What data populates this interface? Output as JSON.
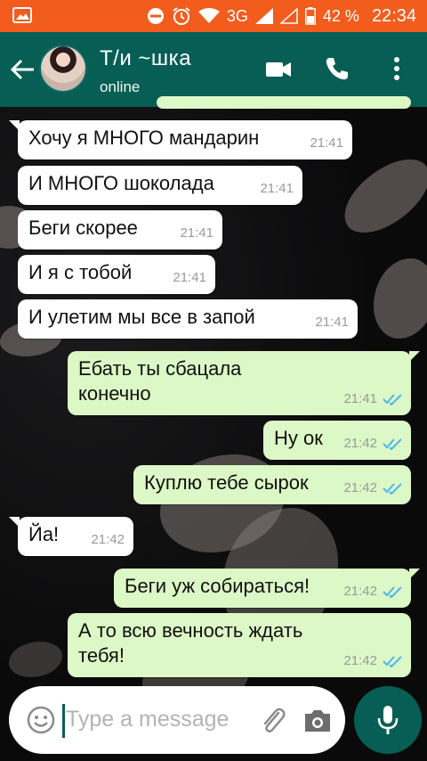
{
  "status_bar": {
    "battery_percent": "42 %",
    "network": "3G",
    "time": "22:34",
    "color": "#f25c1d"
  },
  "header": {
    "contact_name": "Т/и ~шка",
    "status": "online",
    "color": "#075e54"
  },
  "messages": [
    {
      "direction": "in",
      "text": "Хочу я МНОГО мандарин",
      "time": "21:41"
    },
    {
      "direction": "in",
      "text": "И МНОГО шоколада",
      "time": "21:41"
    },
    {
      "direction": "in",
      "text": "Беги скорее",
      "time": "21:41"
    },
    {
      "direction": "in",
      "text": "И я с тобой",
      "time": "21:41"
    },
    {
      "direction": "in",
      "text": "И улетим мы все в запой",
      "time": "21:41"
    },
    {
      "direction": "out",
      "text_line1": "Ебать ты сбацала",
      "text_line2": "конечно",
      "time": "21:41",
      "read": true
    },
    {
      "direction": "out",
      "text": "Ну ок",
      "time": "21:42",
      "read": true
    },
    {
      "direction": "out",
      "text": "Куплю тебе сырок",
      "time": "21:42",
      "read": true
    },
    {
      "direction": "in",
      "text": "Йа!",
      "time": "21:42"
    },
    {
      "direction": "out",
      "text": "Беги уж собираться!",
      "time": "21:42",
      "read": true
    },
    {
      "direction": "out",
      "text_line1": "А то всю вечность ждать",
      "text_line2": "тебя!",
      "time": "21:42",
      "read": true
    }
  ],
  "composer": {
    "placeholder": "Type a message"
  },
  "icons": {
    "back": "arrow-left-icon",
    "video": "video-call-icon",
    "call": "phone-icon",
    "menu": "more-vert-icon",
    "emoji": "emoji-icon",
    "attach": "paperclip-icon",
    "camera": "camera-icon",
    "mic": "mic-icon",
    "read": "double-check-icon"
  },
  "colors": {
    "incoming_bubble": "#ffffff",
    "outgoing_bubble": "#dcf8c6",
    "read_ticks": "#4fb6ec"
  }
}
